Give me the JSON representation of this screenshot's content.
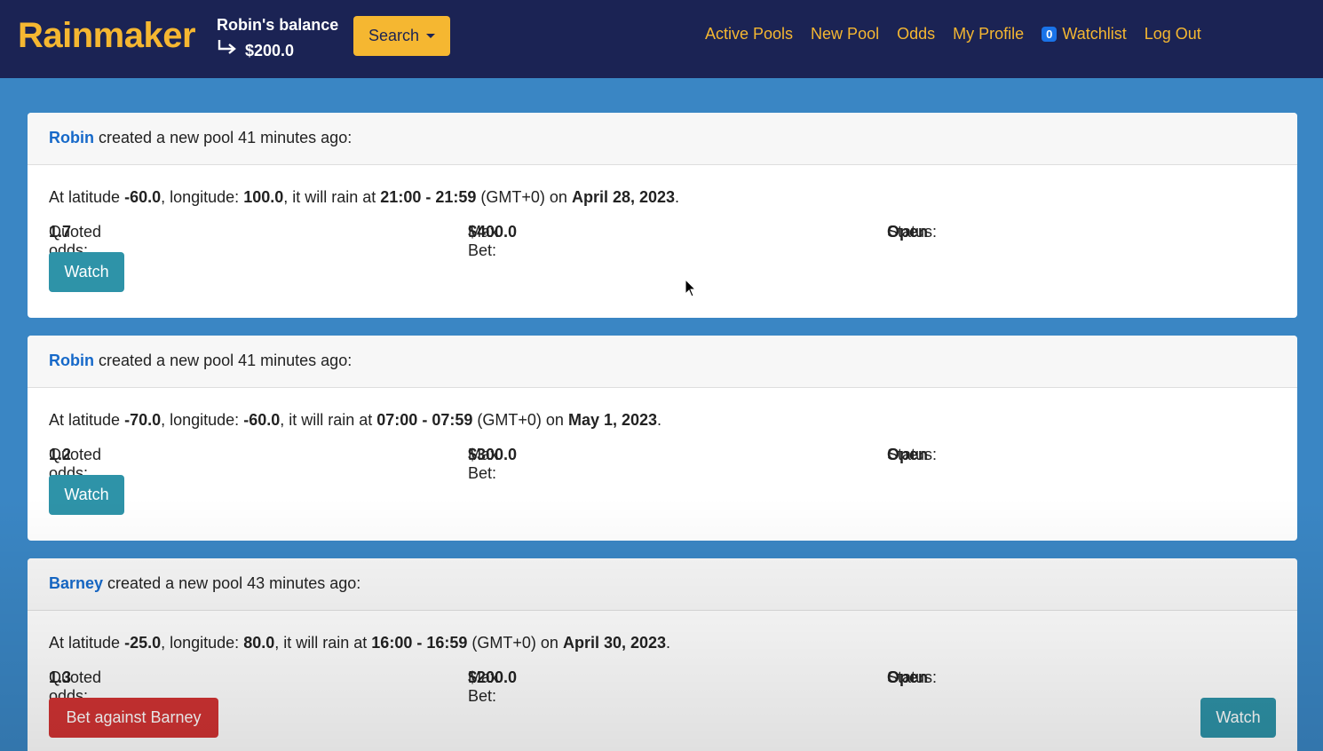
{
  "navbar": {
    "brand": "Rainmaker",
    "balance_label": "Robin's balance",
    "balance_amount": "$200.0",
    "search_label": "Search",
    "links": [
      "Active Pools",
      "New Pool",
      "Odds",
      "My Profile"
    ],
    "watchlist_count": "0",
    "watchlist_label": "Watchlist",
    "logout_label": "Log Out"
  },
  "pools": [
    {
      "user": "Robin",
      "header_suffix": "created a new pool 41 minutes ago:",
      "lat": "-60.0",
      "lon": "100.0",
      "time": "21:00 - 21:59",
      "tz": "(GMT+0)",
      "date": "April 28, 2023",
      "odds": "1.7",
      "max_bet": "$400.0",
      "status": "Open",
      "watch_label": "Watch"
    },
    {
      "user": "Robin",
      "header_suffix": "created a new pool 41 minutes ago:",
      "lat": "-70.0",
      "lon": "-60.0",
      "time": "07:00 - 07:59",
      "tz": "(GMT+0)",
      "date": "May 1, 2023",
      "odds": "1.2",
      "max_bet": "$300.0",
      "status": "Open",
      "watch_label": "Watch"
    },
    {
      "user": "Barney",
      "header_suffix": "created a new pool 43 minutes ago:",
      "lat": "-25.0",
      "lon": "80.0",
      "time": "16:00 - 16:59",
      "tz": "(GMT+0)",
      "date": "April 30, 2023",
      "odds": "1.3",
      "max_bet": "$200.0",
      "status": "Open",
      "bet_label": "Bet against Barney",
      "watch_label": "Watch"
    }
  ],
  "labels": {
    "at_latitude": "At latitude",
    "longitude": ", longitude:",
    "rain_at": ", it will rain at",
    "on": "on",
    "quoted_odds": "Quoted odds:",
    "max_bet": "Max Bet:",
    "status": "Status:"
  }
}
